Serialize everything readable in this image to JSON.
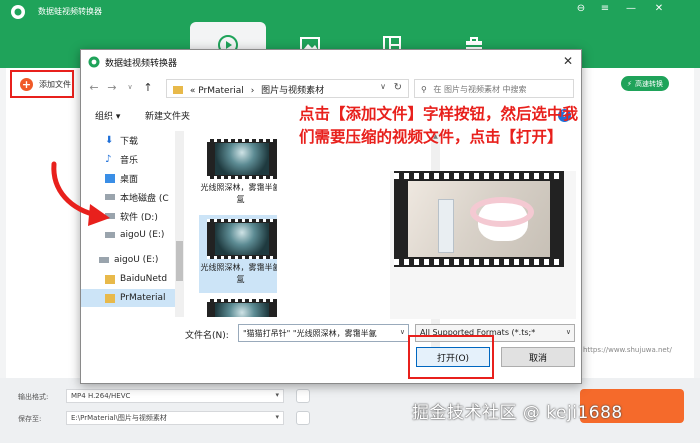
{
  "app": {
    "title": "数据蛙视频转换器",
    "add_file_label": "添加文件",
    "compress_label": "高速转换",
    "window_controls": [
      "⊖",
      "≡",
      "—",
      "✕"
    ]
  },
  "bottom": {
    "format_label": "输出格式:",
    "format_value": "MP4 H.264/HEVC",
    "save_label": "保存至:",
    "save_value": "E:\\PrMaterial\\图片与视频素材"
  },
  "dialog": {
    "title": "数据蛙视频转换器",
    "close": "✕",
    "path_prefix": "«",
    "path_parts": [
      "PrMaterial",
      "图片与视频素材"
    ],
    "path_sep": "›",
    "search_placeholder": "在 图片与视频素材 中搜索",
    "organize_label": "组织 ▾",
    "new_folder_label": "新建文件夹",
    "help": "?",
    "nav_items": [
      {
        "label": "下载",
        "icon": "download-icon"
      },
      {
        "label": "音乐",
        "icon": "music-icon"
      },
      {
        "label": "桌面",
        "icon": "desktop-icon"
      },
      {
        "label": "本地磁盘 (C",
        "icon": "drive-icon"
      },
      {
        "label": "软件 (D:)",
        "icon": "drive-icon"
      },
      {
        "label": "aigoU (E:)",
        "icon": "drive-icon"
      },
      {
        "label": "aigoU (E:)",
        "icon": "drive-icon"
      },
      {
        "label": "BaiduNetd",
        "icon": "folder-icon"
      },
      {
        "label": "PrMaterial",
        "icon": "folder-icon"
      }
    ],
    "files": [
      {
        "name": "光线照深林，雾霭半氤氲"
      },
      {
        "name": "光线照深林，雾霭半氤氲"
      }
    ],
    "filename_label": "文件名(N):",
    "filename_value": "\"猫猫打吊针\" \"光线照深林，雾霭半氤",
    "filetype_value": "All Supported Formats (*.ts;*",
    "open_label": "打开(O)",
    "cancel_label": "取消"
  },
  "annotation": "点击【添加文件】字样按钮，然后选中我们需要压缩的视频文件，点击【打开】",
  "watermarks": {
    "url": "https://www.shujuwa.net/",
    "text": "掘金技术社区 @ keji1688"
  },
  "colors": {
    "brand_green": "#1fa35a",
    "annotation_red": "#e8201c",
    "orange": "#f56a2b",
    "selection_blue": "#cce4f7"
  }
}
